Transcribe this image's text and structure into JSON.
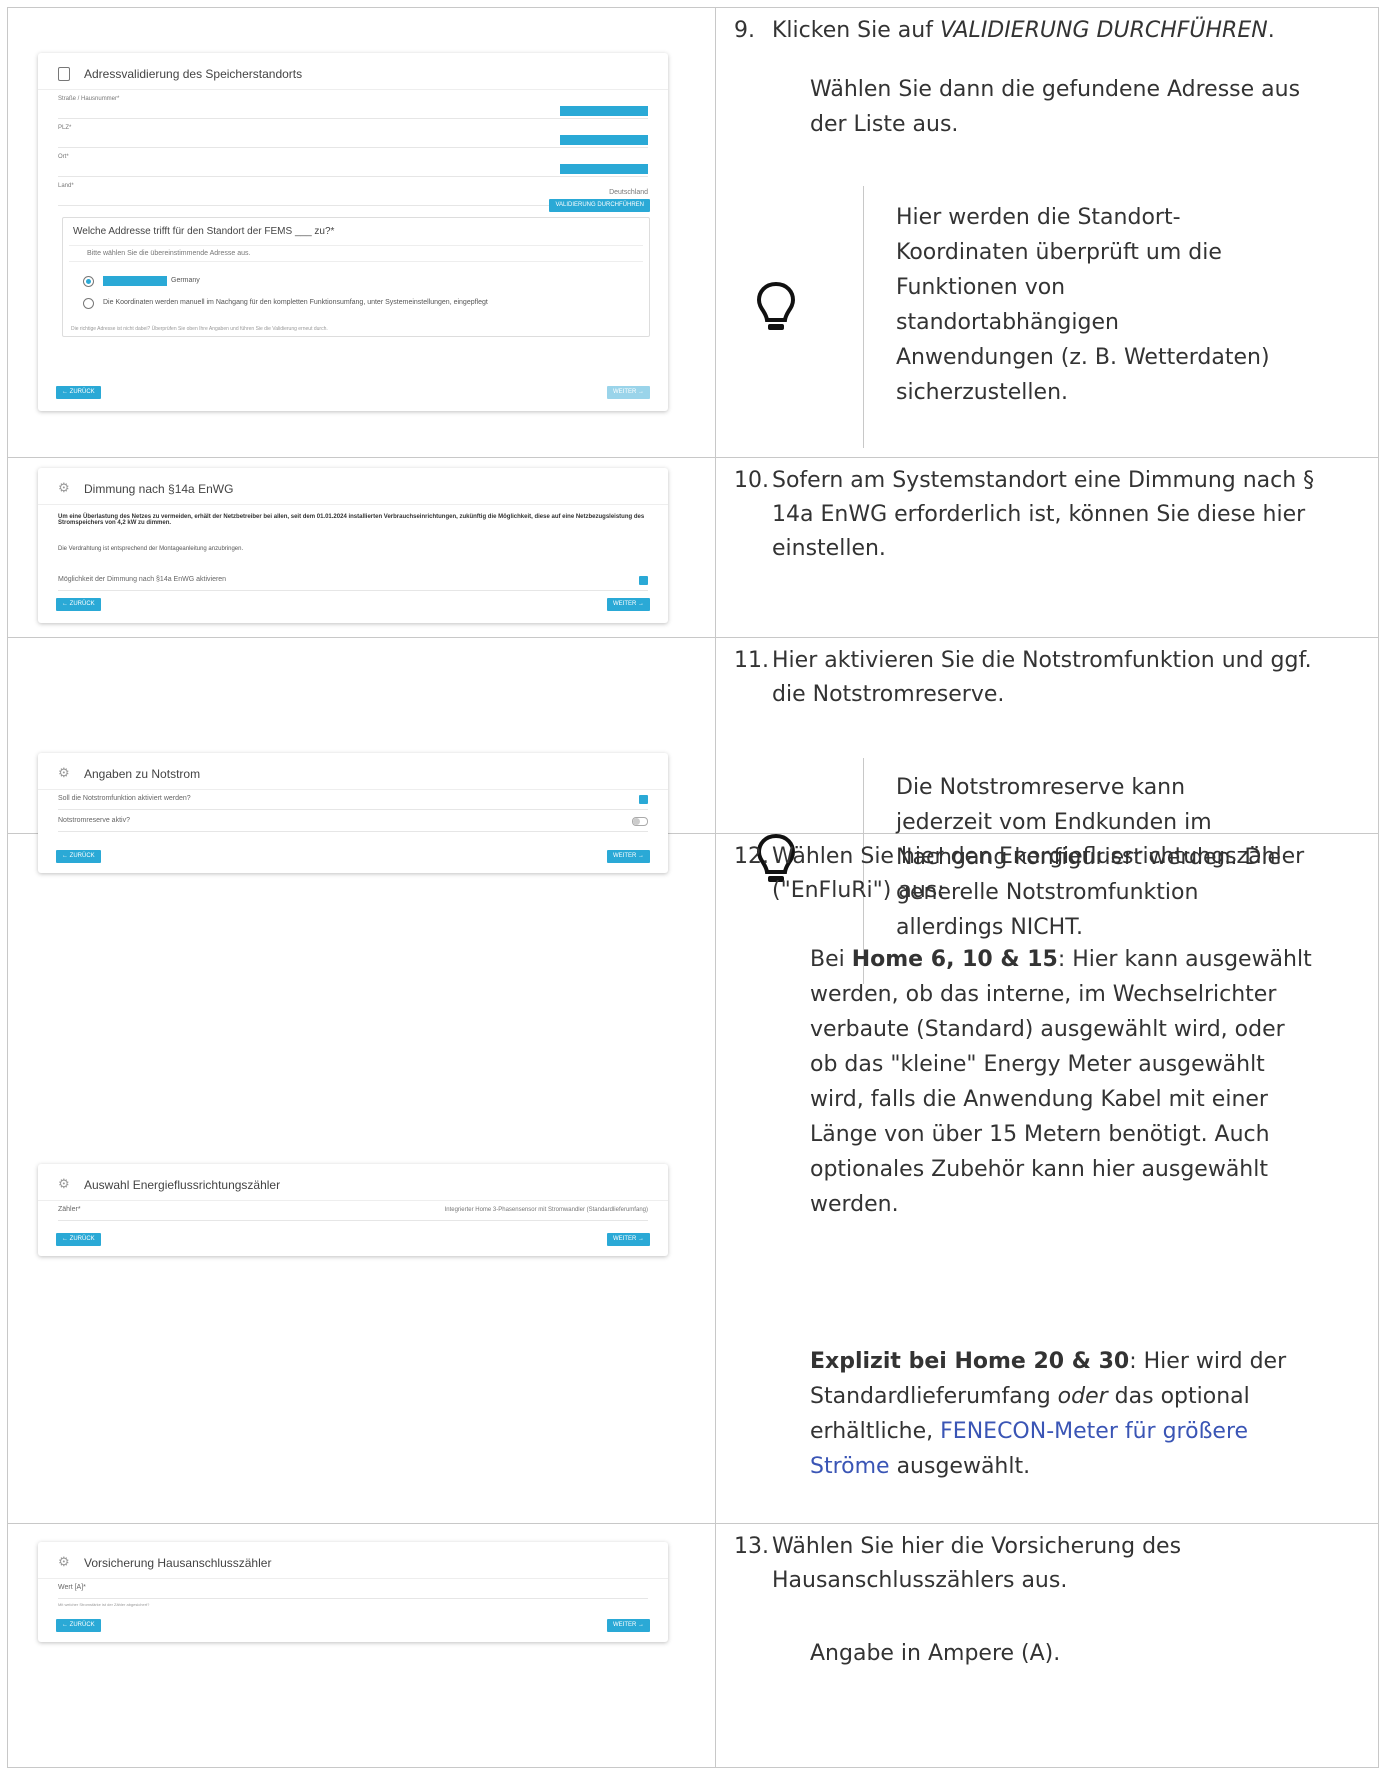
{
  "rows": [
    {
      "screenshot": {
        "title": "Adressvalidierung des Speicherstandorts",
        "fields": [
          "Straße / Hausnummer*",
          "PLZ*",
          "Ort*",
          "Land*"
        ],
        "country_value": "Deutschland",
        "validate_button": "VALIDIERUNG DURCHFÜHREN",
        "question": "Welche Addresse trifft für den Standort der FEMS ___ zu?*",
        "hint": "Bitte wählen Sie die übereinstimmende Adresse aus.",
        "option1": "Germany",
        "option2": "Die Koordinaten werden manuell im Nachgang für den kompletten Funktionsumfang, unter Systemeinstellungen, eingepflegt",
        "note": "Die richtige Adresse ist nicht dabei? Überprüfen Sie oben Ihre Angaben und führen Sie die Validierung erneut durch.",
        "back": "← ZURÜCK",
        "next": "WEITER →"
      },
      "step_num": "9.",
      "step_line1_pre": "Klicken Sie auf ",
      "step_line1_em": "VALIDIERUNG DURCHFÜHREN",
      "step_line1_post": ".",
      "para1": "Wählen Sie dann die gefundene Adresse aus",
      "para2": "der Liste aus.",
      "tip": [
        "Hier werden die Standort-",
        "Koordinaten überprüft um die",
        "Funktionen von",
        "standortabhängigen",
        "Anwendungen (z. B. Wetterdaten)",
        "sicherzustellen."
      ]
    },
    {
      "screenshot": {
        "title": "Dimmung nach §14a EnWG",
        "bold_text": "Um eine Überlastung des Netzes zu vermeiden, erhält der Netzbetreiber bei allen, seit dem 01.01.2024 installierten Verbrauchseinrichtungen, zukünftig die Möglichkeit, diese auf eine Netzbezugsleistung des Stromspeichers von 4,2 kW zu dimmen.",
        "text": "Die Verdrahtung ist entsprechend der Montageanleitung anzubringen.",
        "checkbox_label": "Möglichkeit der Dimmung nach §14a EnWG aktivieren",
        "back": "← ZURÜCK",
        "next": "WEITER →"
      },
      "step_num": "10.",
      "lines": [
        "Sofern am Systemstandort eine Dimmung nach §",
        "14a EnWG erforderlich ist, können Sie diese hier",
        "einstellen."
      ]
    },
    {
      "screenshot": {
        "title": "Angaben zu Notstrom",
        "q1": "Soll die Notstromfunktion aktiviert werden?",
        "q2": "Notstromreserve aktiv?",
        "back": "← ZURÜCK",
        "next": "WEITER →"
      },
      "step_num": "11.",
      "lines": [
        "Hier aktivieren Sie die Notstromfunktion und ggf.",
        "die Notstromreserve."
      ],
      "tip": [
        "Die Notstromreserve kann",
        "jederzeit vom Endkunden im",
        "Nachgang konfiguriert werden. Die",
        "generelle Notstromfunktion",
        "allerdings NICHT."
      ]
    },
    {
      "screenshot": {
        "title": "Auswahl Energieflussrichtungszähler",
        "field": "Zähler*",
        "value": "Integrierter Home 3-Phasensensor mit Stromwandler (Standardlieferumfang)",
        "back": "← ZURÜCK",
        "next": "WEITER →"
      },
      "step_num": "12.",
      "lines": [
        "Wählen Sie hier den Energieflussrichtungszähler",
        "(\"EnFluRi\") aus:"
      ],
      "p1_pre": "Bei ",
      "p1_bold": "Home 6, 10 & 15",
      "p1_lines": [
        ": Hier kann ausgewählt",
        "werden, ob das interne, im Wechselrichter",
        "verbaute (Standard) ausgewählt wird, oder",
        "ob das \"kleine\" Energy Meter ausgewählt",
        "wird, falls die Anwendung Kabel mit einer",
        "Länge von über 15 Metern benötigt. Auch",
        "optionales Zubehör kann hier ausgewählt",
        "werden."
      ],
      "p2_bold": "Explizit bei Home 20 & 30",
      "p2_line1": ": Hier wird der",
      "p2_line2_pre": "Standardlieferumfang ",
      "p2_line2_em": "oder",
      "p2_line2_post": " das optional",
      "p2_line3_pre": "erhältliche, ",
      "p2_line3_link": "FENECON-Meter für größere",
      "p2_line4_link": "Ströme",
      "p2_line4_post": " ausgewählt."
    },
    {
      "screenshot": {
        "title": "Vorsicherung Hausanschlusszähler",
        "field": "Wert [A]*",
        "help": "Mit welcher Stromstärke ist der Zähler abgesichert?",
        "back": "← ZURÜCK",
        "next": "WEITER →"
      },
      "step_num": "13.",
      "lines": [
        "Wählen Sie hier die Vorsicherung des",
        "Hausanschlusszählers aus."
      ],
      "para": "Angabe in Ampere (A)."
    }
  ]
}
